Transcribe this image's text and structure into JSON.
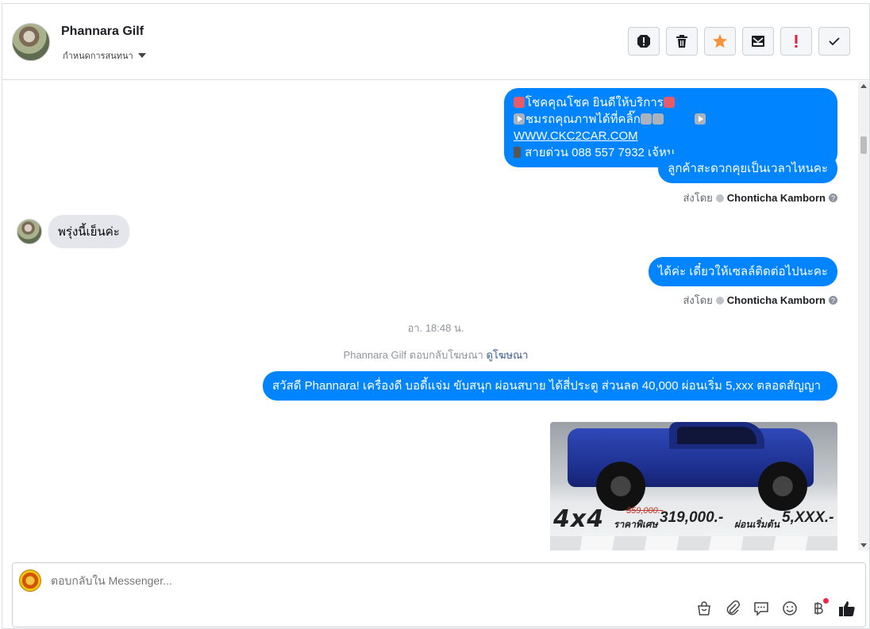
{
  "header": {
    "contact_name": "Phannara Gilf",
    "assign_label": "กำหนดการสนทนา",
    "toolbar": [
      "spam-icon",
      "trash-icon",
      "star-icon",
      "mark-unread-icon",
      "important-icon",
      "done-icon"
    ]
  },
  "messages": {
    "msg1_line1": "โชคคุณโชค ยินดีให้บริการ",
    "msg1_line2": "ชมรถคุณภาพได้ที่คลิ๊ก",
    "msg1_link": "WWW.CKC2CAR.COM",
    "msg1_line3": "สายด่วน 088 557 7932 เจ้หนู",
    "msg2": "ลูกค้าสะดวกคุยเป็นเวลาไหนคะ",
    "sent_by_label": "ส่งโดย",
    "sent_by_name": "Chonticha Kamborn",
    "incoming1": "พรุ่งนี้เย็นค่ะ",
    "msg3": "ได้ค่ะ เดี๋ยวให้เซลล์ติดต่อไปนะคะ",
    "sent_by_label2": "ส่งโดย",
    "sent_by_name2": "Chonticha Kamborn",
    "timestamp": "อา. 18:48 น.",
    "ad_reply_text": "Phannara Gilf ตอบกลับโฆษณา",
    "ad_view_link": "ดูโฆษณา",
    "msg4": "สวัสดี Phannara! เครื่องดี บอดี้แจ่ม ขับสนุก ผ่อนสบาย ได้สี่ประตู ส่วนลด 40,000 ผ่อนเริ่ม 5,xxx ตลอดสัญญา"
  },
  "ad_image": {
    "big_text": "4x4",
    "old_price": "359,000.-",
    "special_label": "ราคาพิเศษ",
    "special_price": "319,000.-",
    "start_label": "ผ่อนเริ่มต้น",
    "start_price": "5,XXX.-"
  },
  "composer": {
    "placeholder": "ตอบกลับใน Messenger...",
    "icons": [
      "bag-icon",
      "attachment-icon",
      "saved-reply-icon",
      "emoji-icon",
      "baht-icon",
      "like-icon"
    ]
  },
  "colors": {
    "outgoing_bubble": "#0084ff",
    "incoming_bubble": "#e4e6eb",
    "star": "#f7923b",
    "important": "#e41e3f"
  }
}
